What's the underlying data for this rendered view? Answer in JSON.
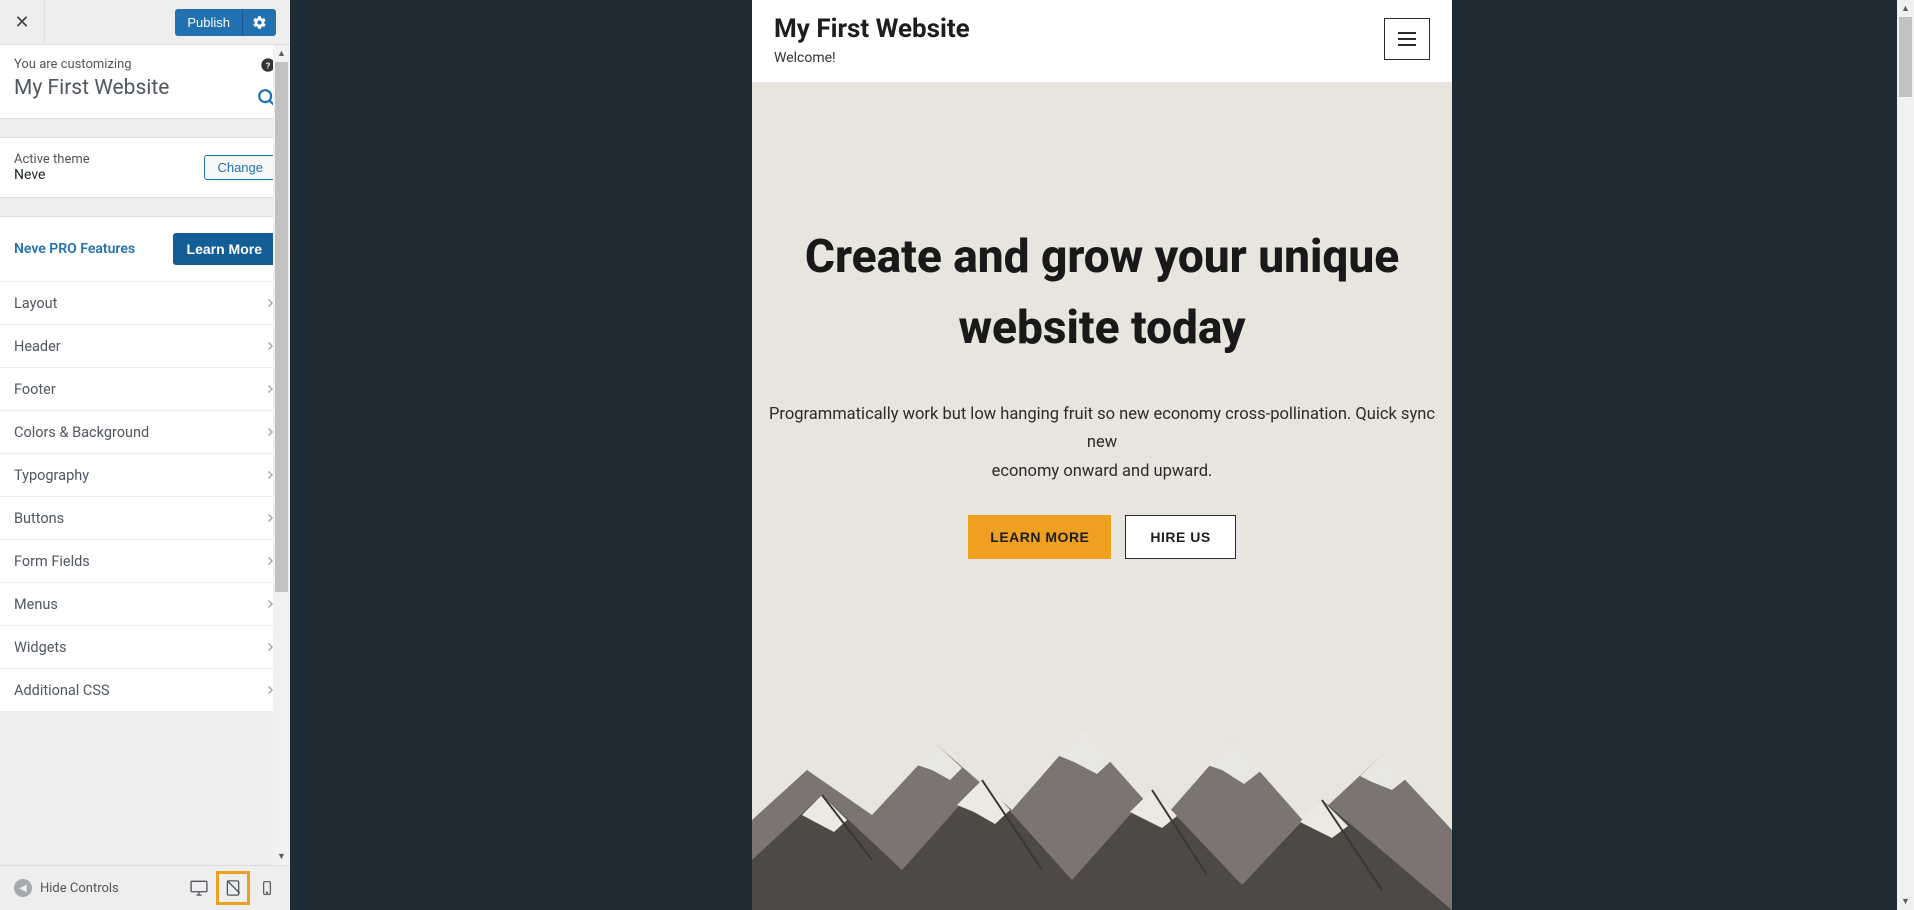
{
  "sidebar": {
    "publish_label": "Publish",
    "customizing_label": "You are customizing",
    "site_title": "My First Website",
    "active_theme_label": "Active theme",
    "theme_name": "Neve",
    "change_label": "Change",
    "pro_label": "Neve PRO Features",
    "learn_more_label": "Learn More",
    "items": [
      {
        "label": "Layout"
      },
      {
        "label": "Header"
      },
      {
        "label": "Footer"
      },
      {
        "label": "Colors & Background"
      },
      {
        "label": "Typography"
      },
      {
        "label": "Buttons"
      },
      {
        "label": "Form Fields"
      },
      {
        "label": "Menus"
      },
      {
        "label": "Widgets"
      },
      {
        "label": "Additional CSS"
      }
    ],
    "hide_controls_label": "Hide Controls"
  },
  "preview": {
    "site_title": "My First Website",
    "tagline": "Welcome!",
    "hero_heading": "Create and grow your unique website today",
    "hero_para_line1": "Programmatically work but low hanging fruit so new economy cross-pollination. Quick sync new",
    "hero_para_line2": "economy onward and upward.",
    "cta_primary": "LEARN MORE",
    "cta_secondary": "HIRE US"
  },
  "colors": {
    "wp_blue": "#2271b1",
    "accent_orange": "#f0a020",
    "dark_bg": "#1e2a34"
  }
}
